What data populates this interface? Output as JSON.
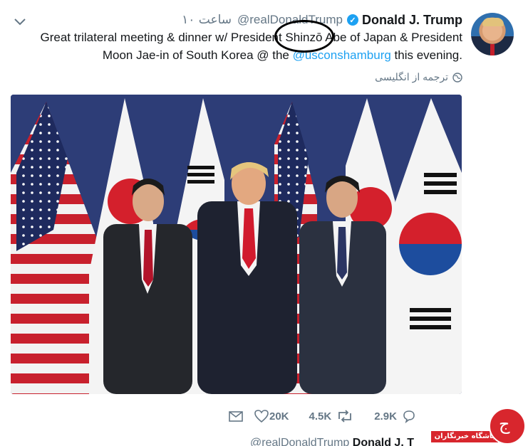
{
  "tweet": {
    "name": "Donald J. Trump",
    "handle": "@realDonaldTrump",
    "time": "۱۰ ساعت",
    "text_part1": "Great trilateral meeting & dinner w/ President Shinzō Abe of Japan & President Moon Jae-in of South Korea @ the ",
    "text_link": "@usconshamburg",
    "text_part2": " this evening.",
    "translate_label": "ترجمه از انگلیسی",
    "photo_alt": "photo",
    "actions": {
      "likes": "20K",
      "retweets": "4.5K",
      "replies": "2.9K"
    }
  },
  "watermark": {
    "label": "باشگاه خبرنگاران"
  },
  "next_tweet": {
    "handle": "@realDonaldTrump",
    "name": "Donald J. T"
  },
  "colors": {
    "link": "#1da1f2",
    "muted": "#657786",
    "brand_red": "#d8262d"
  }
}
